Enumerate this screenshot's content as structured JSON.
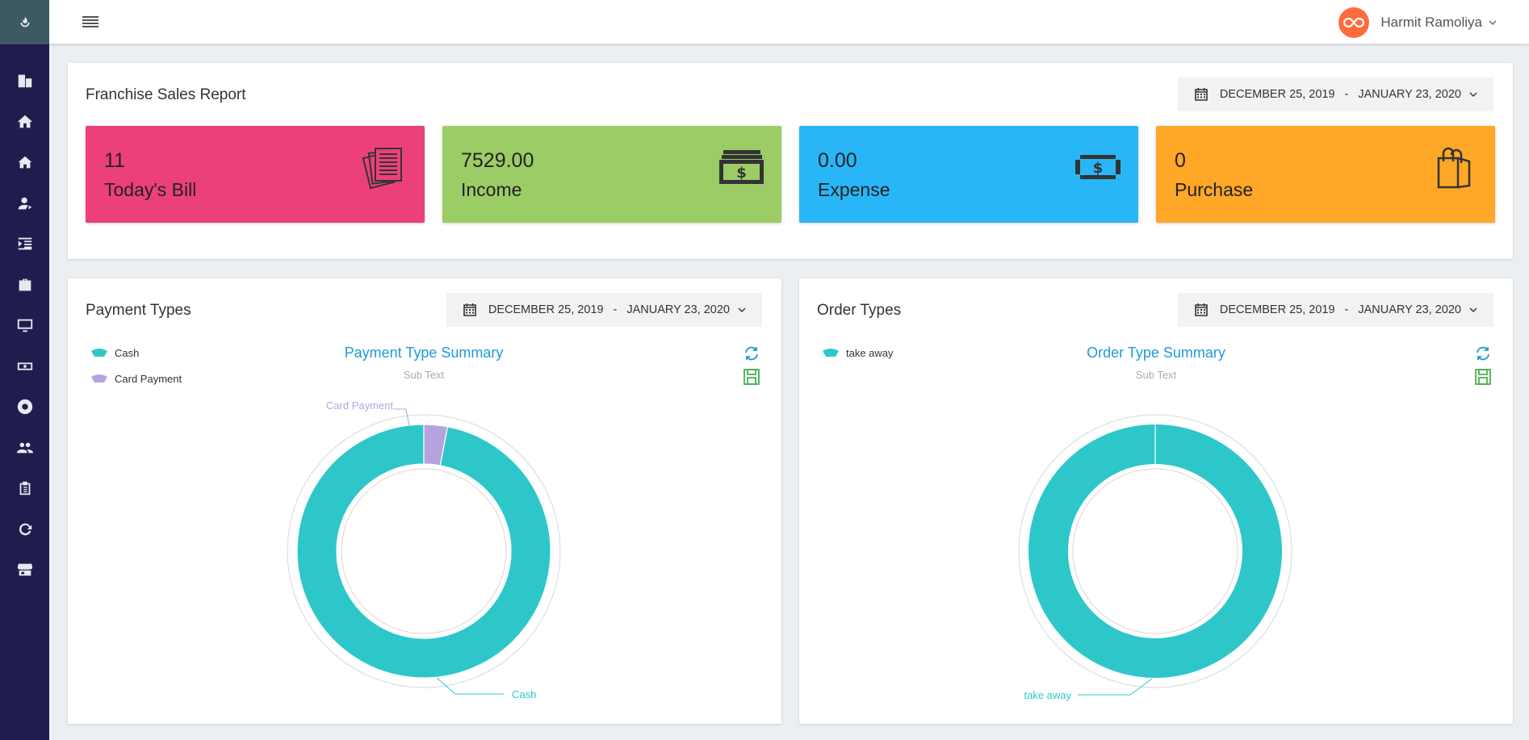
{
  "user": {
    "name": "Harmit Ramoliya"
  },
  "sidebar": {
    "items": [
      {
        "icon": "building-icon"
      },
      {
        "icon": "home-icon"
      },
      {
        "icon": "house-icon"
      },
      {
        "icon": "user-icon"
      },
      {
        "icon": "indent-list-icon"
      },
      {
        "icon": "briefcase-icon"
      },
      {
        "icon": "monitor-icon"
      },
      {
        "icon": "money-icon"
      },
      {
        "icon": "lifebuoy-icon"
      },
      {
        "icon": "users-icon"
      },
      {
        "icon": "clipboard-icon"
      },
      {
        "icon": "refresh-icon"
      },
      {
        "icon": "store-icon"
      }
    ]
  },
  "sales_report": {
    "title": "Franchise Sales Report",
    "date_range": {
      "start": "DECEMBER 25, 2019",
      "separator": "-",
      "end": "JANUARY 23, 2020"
    },
    "tiles": [
      {
        "value": "11",
        "label": "Today's Bill",
        "color": "#ec407a",
        "icon": "bills-icon"
      },
      {
        "value": "7529.00",
        "label": "Income",
        "color": "#9ccc65",
        "icon": "cash-stack-icon"
      },
      {
        "value": "0.00",
        "label": "Expense",
        "color": "#29b6f6",
        "icon": "banknote-icon"
      },
      {
        "value": "0",
        "label": "Purchase",
        "color": "#ffa726",
        "icon": "shopping-bag-icon"
      }
    ]
  },
  "payment_types": {
    "title": "Payment Types",
    "date_range": {
      "start": "DECEMBER 25, 2019",
      "separator": "-",
      "end": "JANUARY 23, 2020"
    },
    "chart_title": "Payment Type Summary",
    "chart_subtitle": "Sub Text",
    "legend": [
      {
        "name": "Cash",
        "color": "#2ec7c9"
      },
      {
        "name": "Card Payment",
        "color": "#b6a2de"
      }
    ]
  },
  "order_types": {
    "title": "Order Types",
    "date_range": {
      "start": "DECEMBER 25, 2019",
      "separator": "-",
      "end": "JANUARY 23, 2020"
    },
    "chart_title": "Order Type Summary",
    "chart_subtitle": "Sub Text",
    "legend": [
      {
        "name": "take away",
        "color": "#2ec7c9"
      }
    ]
  },
  "chart_data": [
    {
      "type": "pie",
      "title": "Payment Type Summary",
      "subtitle": "Sub Text",
      "categories": [
        "Cash",
        "Card Payment"
      ],
      "values": [
        97,
        3
      ],
      "colors": [
        "#2ec7c9",
        "#b6a2de"
      ],
      "legend": "top-left"
    },
    {
      "type": "pie",
      "title": "Order Type Summary",
      "subtitle": "Sub Text",
      "categories": [
        "take away"
      ],
      "values": [
        100
      ],
      "colors": [
        "#2ec7c9"
      ],
      "legend": "top-left"
    }
  ]
}
